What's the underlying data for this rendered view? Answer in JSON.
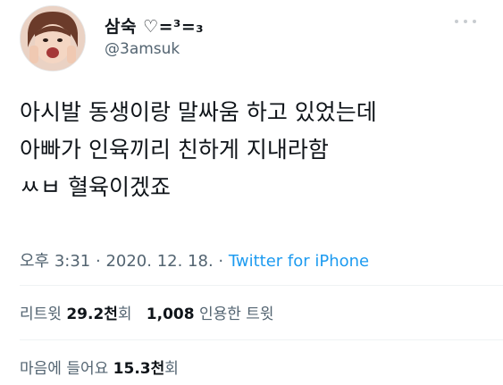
{
  "user": {
    "display_name": "삼숙 ♡=³=₃",
    "handle": "@3amsuk"
  },
  "tweet": {
    "lines": [
      "아시발 동생이랑 말싸움 하고 있었는데",
      "아빠가 인육끼리 친하게 지내라함",
      "ㅆㅂ 혈육이겠죠"
    ],
    "time": "오후 3:31",
    "sep1": " · ",
    "date": "2020. 12. 18.",
    "sep2": " · ",
    "source": "Twitter for iPhone"
  },
  "stats": {
    "retweet_label": "리트윗",
    "retweet_count": "29.2천",
    "retweet_suffix": "회",
    "quote_count": "1,008",
    "quote_label": "인용한 트윗",
    "like_label": "마음에 들어요",
    "like_count": "15.3천",
    "like_suffix": "회"
  },
  "icons": {
    "more": "more-dots-icon"
  }
}
